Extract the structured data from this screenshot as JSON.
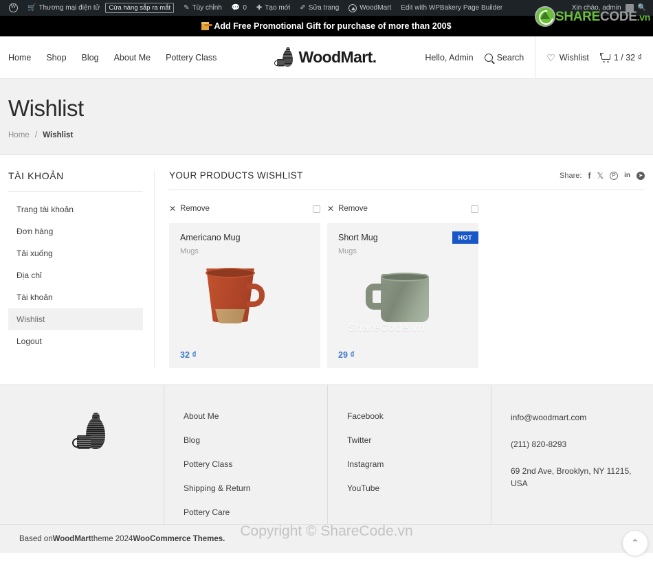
{
  "adminbar": {
    "wp_logo": "wordpress-icon",
    "items": [
      {
        "label": "Thương mại điện tử",
        "icon": "cart-icon"
      },
      {
        "label": "Tùy chỉnh",
        "icon": "brush-icon"
      },
      {
        "label": "0",
        "icon": "comment-icon"
      },
      {
        "label": "Tạo mới",
        "icon": "plus-icon"
      },
      {
        "label": "Sửa trang",
        "icon": "pencil-icon"
      },
      {
        "label": "WoodMart",
        "icon": "woodmart-icon"
      },
      {
        "label": "Edit with WPBakery Page Builder",
        "icon": null
      }
    ],
    "pill_label": "Cửa hàng sắp ra mắt",
    "greeting": "Xin chào, admin",
    "search_icon": "search-icon"
  },
  "watermark": {
    "logo_share": "SHARE",
    "logo_code": "CODE",
    "logo_tld": ".vn",
    "copyright": "Copyright © ShareCode.vn",
    "product_overlay": "ShareCode.vn"
  },
  "promo": {
    "icon": "gift-icon",
    "text": "Add Free Promotional Gift for purchase of more than 200$"
  },
  "header": {
    "nav": [
      {
        "label": "Home"
      },
      {
        "label": "Shop"
      },
      {
        "label": "Blog"
      },
      {
        "label": "About Me"
      },
      {
        "label": "Pottery Class"
      }
    ],
    "brand": "WoodMart.",
    "greeting": "Hello, Admin",
    "search_label": "Search",
    "wishlist_label": "Wishlist",
    "cart_label": "1 / 32 ₫"
  },
  "page": {
    "title": "Wishlist",
    "breadcrumb_home": "Home",
    "breadcrumb_sep": "/",
    "breadcrumb_current": "Wishlist"
  },
  "sidebar": {
    "title": "TÀI KHOẢN",
    "items": [
      {
        "label": "Trang tài khoản",
        "active": false
      },
      {
        "label": "Đơn hàng",
        "active": false
      },
      {
        "label": "Tải xuống",
        "active": false
      },
      {
        "label": "Địa chỉ",
        "active": false
      },
      {
        "label": "Tài khoản",
        "active": false
      },
      {
        "label": "Wishlist",
        "active": true
      },
      {
        "label": "Logout",
        "active": false
      }
    ]
  },
  "wishlist": {
    "heading": "YOUR PRODUCTS WISHLIST",
    "share_label": "Share:",
    "share_icons": [
      {
        "name": "facebook-icon",
        "glyph": "f"
      },
      {
        "name": "x-twitter-icon",
        "glyph": "✕"
      },
      {
        "name": "pinterest-icon",
        "glyph": "P"
      },
      {
        "name": "linkedin-icon",
        "glyph": "in"
      },
      {
        "name": "telegram-icon",
        "glyph": "➤"
      }
    ],
    "remove_label": "Remove",
    "products": [
      {
        "name": "Americano Mug",
        "category": "Mugs",
        "price": "32 ₫",
        "badge": null,
        "image": "americano-mug-photo"
      },
      {
        "name": "Short Mug",
        "category": "Mugs",
        "price": "29 ₫",
        "badge": "HOT",
        "image": "short-mug-photo"
      }
    ]
  },
  "footer": {
    "logo": "woodmart-vase-logo",
    "col1": [
      {
        "label": "About Me"
      },
      {
        "label": "Blog"
      },
      {
        "label": "Pottery Class"
      },
      {
        "label": "Shipping & Return"
      },
      {
        "label": "Pottery Care"
      }
    ],
    "col2": [
      {
        "label": "Facebook"
      },
      {
        "label": "Twitter"
      },
      {
        "label": "Instagram"
      },
      {
        "label": "YouTube"
      }
    ],
    "contact": {
      "email": "info@woodmart.com",
      "phone": "(211) 820-8293",
      "address": "69 2nd Ave, Brooklyn, NY 11215, USA"
    },
    "credit_prefix": "Based on ",
    "credit_brand": "WoodMart",
    "credit_mid": " theme 2024 ",
    "credit_suffix": "WooCommerce Themes.",
    "scroll_top_icon": "chevron-up-icon"
  },
  "colors": {
    "accent_blue": "#1757c8",
    "price_blue": "#3f7bc4",
    "watermark_green": "#6bbf3a",
    "promo_bg": "#000000",
    "adminbar_bg": "#1d2327"
  }
}
